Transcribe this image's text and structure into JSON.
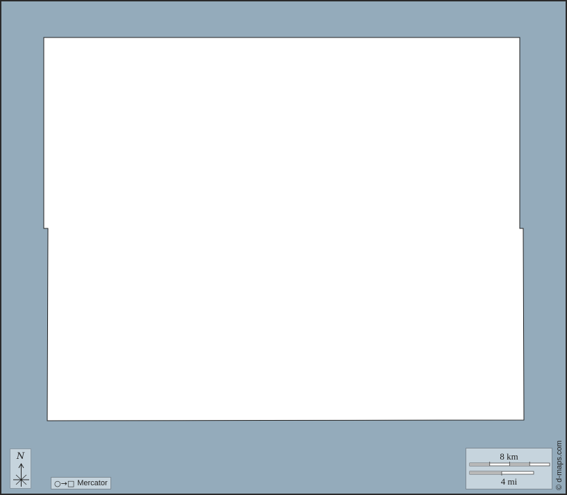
{
  "map": {
    "colors": {
      "water": "#94abbb",
      "land": "#ffffff",
      "panel": "#c6d4dd",
      "outline": "#222222"
    }
  },
  "north_arrow": {
    "label": "N"
  },
  "projection": {
    "symbol": "○→□",
    "name": "Mercator"
  },
  "scale_bar": {
    "metric_label": "8 km",
    "imperial_label": "4 mi"
  },
  "credit": "© d-maps.com"
}
